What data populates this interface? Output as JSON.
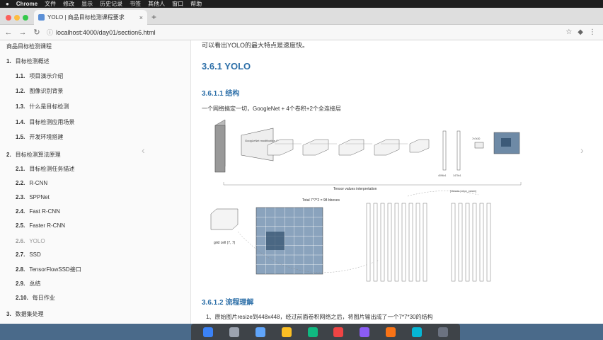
{
  "menubar": {
    "app": "Chrome",
    "items": [
      "文件",
      "修改",
      "显示",
      "历史记录",
      "书签",
      "其他人",
      "窗口",
      "帮助"
    ]
  },
  "tab": {
    "title": "YOLO | 商品目标检测课程要求",
    "close": "×",
    "new_tab": "+"
  },
  "address": {
    "back": "←",
    "forward": "→",
    "reload": "↻",
    "lock": "ⓘ",
    "url": "localhost:4000/day01/section6.html"
  },
  "sidebar": {
    "title": "商品目标检测课程",
    "items": [
      {
        "num": "1.",
        "label": "目标检测概述",
        "level": "chapter"
      },
      {
        "num": "1.1.",
        "label": "项目演示介绍",
        "level": "section"
      },
      {
        "num": "1.2.",
        "label": "图像识别背景",
        "level": "section"
      },
      {
        "num": "1.3.",
        "label": "什么是目标检测",
        "level": "section"
      },
      {
        "num": "1.4.",
        "label": "目标检测应用场景",
        "level": "section"
      },
      {
        "num": "1.5.",
        "label": "开发环境搭建",
        "level": "section"
      },
      {
        "num": "2.",
        "label": "目标检测算法原理",
        "level": "chapter"
      },
      {
        "num": "2.1.",
        "label": "目标检测任务描述",
        "level": "section"
      },
      {
        "num": "2.2.",
        "label": "R-CNN",
        "level": "section"
      },
      {
        "num": "2.3.",
        "label": "SPPNet",
        "level": "section"
      },
      {
        "num": "2.4.",
        "label": "Fast R-CNN",
        "level": "section"
      },
      {
        "num": "2.5.",
        "label": "Faster R-CNN",
        "level": "section"
      },
      {
        "num": "2.6.",
        "label": "YOLO",
        "level": "section"
      },
      {
        "num": "2.7.",
        "label": "SSD",
        "level": "section"
      },
      {
        "num": "2.8.",
        "label": "TensorFlowSSD接口",
        "level": "section"
      },
      {
        "num": "2.9.",
        "label": "总结",
        "level": "section"
      },
      {
        "num": "2.10.",
        "label": "每日作业",
        "level": "section"
      },
      {
        "num": "3.",
        "label": "数据集处理",
        "level": "chapter"
      }
    ]
  },
  "content": {
    "intro": "可以看出YOLO的最大特点是速度快。",
    "h2": "3.6.1 YOLO",
    "h3_structure": "3.6.1.1 结构",
    "para": "一个网络搞定一切，GoogleNet + 4个卷积+2个全连接层",
    "h3_flow": "3.6.1.2 流程理解",
    "bullet": "1、原始图片resize到448x448，经过前面卷积网络之后，将图片输出成了一个7*7*30的结构",
    "diagram": {
      "tensor_label": "Tensor values interpretation",
      "total_label": "Total 7*7*2 = 98 bboxes",
      "grid_label": "grid cell (7, 7)",
      "top_label": "[Classes | bbox_param]",
      "googlenet_label": "GoogLeNet modification (20 layers)",
      "fc_labels": [
        "4096x1",
        "1470x1"
      ],
      "output_label": "7x7x30"
    }
  },
  "colors": {
    "heading": "#2d6fa8",
    "menubar": "#1e1e1e",
    "sidebar_bg": "#fafafa"
  }
}
